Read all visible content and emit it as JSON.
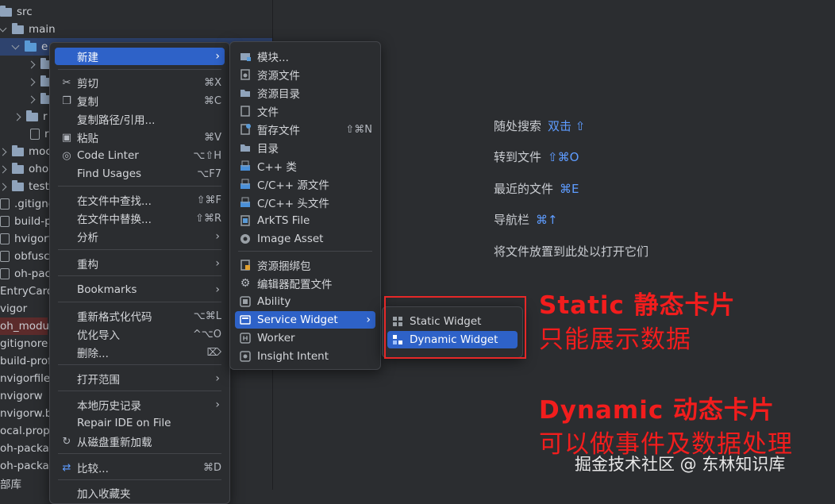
{
  "tree": {
    "items": [
      {
        "label": "src"
      },
      {
        "label": "main"
      },
      {
        "label": "e"
      },
      {
        "label": ""
      },
      {
        "label": ""
      },
      {
        "label": ""
      },
      {
        "label": "r"
      },
      {
        "label": "r"
      },
      {
        "label": "moc"
      },
      {
        "label": "oho"
      },
      {
        "label": "test"
      },
      {
        "label": ".gitignc"
      },
      {
        "label": "build-p"
      },
      {
        "label": "hvigorfi"
      },
      {
        "label": "obfusca"
      },
      {
        "label": "oh-pac"
      },
      {
        "label": "EntryCard"
      },
      {
        "label": "vigor"
      },
      {
        "label": "oh_modul"
      },
      {
        "label": "gitignore"
      },
      {
        "label": "build-profi"
      },
      {
        "label": "nvigorfile.t"
      },
      {
        "label": "nvigorw"
      },
      {
        "label": "nvigorw.ba"
      },
      {
        "label": "ocal.prop"
      },
      {
        "label": "oh-packag"
      },
      {
        "label": "oh-packag"
      },
      {
        "label": "部库"
      }
    ]
  },
  "context_menu": {
    "items": [
      {
        "label": "新建",
        "shortcut": "",
        "icon": ""
      },
      {
        "label": "剪切",
        "shortcut": "⌘X",
        "icon": "scissors-icon"
      },
      {
        "label": "复制",
        "shortcut": "⌘C",
        "icon": "copy-icon"
      },
      {
        "label": "复制路径/引用...",
        "shortcut": "",
        "icon": ""
      },
      {
        "label": "粘贴",
        "shortcut": "⌘V",
        "icon": "paste-icon"
      },
      {
        "label": "Code Linter",
        "shortcut": "⌥⇧H",
        "icon": "linter-icon"
      },
      {
        "label": "Find Usages",
        "shortcut": "⌥F7",
        "icon": ""
      },
      {
        "label": "在文件中查找...",
        "shortcut": "⇧⌘F",
        "icon": ""
      },
      {
        "label": "在文件中替换...",
        "shortcut": "⇧⌘R",
        "icon": ""
      },
      {
        "label": "分析",
        "shortcut": "",
        "icon": ""
      },
      {
        "label": "重构",
        "shortcut": "",
        "icon": ""
      },
      {
        "label": "Bookmarks",
        "shortcut": "",
        "icon": ""
      },
      {
        "label": "重新格式化代码",
        "shortcut": "⌥⌘L",
        "icon": ""
      },
      {
        "label": "优化导入",
        "shortcut": "^⌥O",
        "icon": ""
      },
      {
        "label": "删除...",
        "shortcut": "⌦",
        "icon": ""
      },
      {
        "label": "打开范围",
        "shortcut": "",
        "icon": ""
      },
      {
        "label": "本地历史记录",
        "shortcut": "",
        "icon": ""
      },
      {
        "label": "Repair IDE on File",
        "shortcut": "",
        "icon": ""
      },
      {
        "label": "从磁盘重新加载",
        "shortcut": "",
        "icon": "reload-icon"
      },
      {
        "label": "比较...",
        "shortcut": "⌘D",
        "icon": "compare-icon"
      },
      {
        "label": "加入收藏夹",
        "shortcut": "",
        "icon": ""
      }
    ]
  },
  "new_menu": {
    "items": [
      {
        "label": "模块...",
        "shortcut": "",
        "icon": "module-icon"
      },
      {
        "label": "资源文件",
        "shortcut": "",
        "icon": "resource-file-icon"
      },
      {
        "label": "资源目录",
        "shortcut": "",
        "icon": "folder-icon"
      },
      {
        "label": "文件",
        "shortcut": "",
        "icon": "file-icon"
      },
      {
        "label": "暂存文件",
        "shortcut": "⇧⌘N",
        "icon": "scratch-file-icon"
      },
      {
        "label": "目录",
        "shortcut": "",
        "icon": "directory-icon"
      },
      {
        "label": "C++ 类",
        "shortcut": "",
        "icon": "cpp-class-icon"
      },
      {
        "label": "C/C++ 源文件",
        "shortcut": "",
        "icon": "cpp-source-icon"
      },
      {
        "label": "C/C++ 头文件",
        "shortcut": "",
        "icon": "cpp-header-icon"
      },
      {
        "label": "ArkTS File",
        "shortcut": "",
        "icon": "arkts-icon"
      },
      {
        "label": "Image Asset",
        "shortcut": "",
        "icon": "image-asset-icon"
      },
      {
        "label": "资源捆绑包",
        "shortcut": "",
        "icon": "resource-bundle-icon"
      },
      {
        "label": "编辑器配置文件",
        "shortcut": "",
        "icon": "gear-icon"
      },
      {
        "label": "Ability",
        "shortcut": "",
        "icon": "ability-icon"
      },
      {
        "label": "Service Widget",
        "shortcut": "",
        "icon": "widget-icon"
      },
      {
        "label": "Worker",
        "shortcut": "",
        "icon": "worker-icon"
      },
      {
        "label": "Insight Intent",
        "shortcut": "",
        "icon": "intent-icon"
      }
    ]
  },
  "widget_menu": {
    "items": [
      {
        "label": "Static Widget",
        "icon": "static-widget-icon"
      },
      {
        "label": "Dynamic Widget",
        "icon": "dynamic-widget-icon"
      }
    ]
  },
  "hints": [
    {
      "label": "随处搜索",
      "key": "双击 ⇧"
    },
    {
      "label": "转到文件",
      "key": "⇧⌘O"
    },
    {
      "label": "最近的文件",
      "key": "⌘E"
    },
    {
      "label": "导航栏",
      "key": "⌘↑"
    },
    {
      "label": "将文件放置到此处以打开它们",
      "key": ""
    }
  ],
  "annotations": {
    "static_line1": "Static 静态卡片",
    "static_line2": "只能展示数据",
    "dynamic_line1": "Dynamic 动态卡片",
    "dynamic_line2": "可以做事件及数据处理"
  },
  "watermark": "掘金技术社区 @ 东林知识库",
  "colors": {
    "accent": "#2e62c8",
    "annotation": "#f21d1d",
    "hint_key": "#5e9cff"
  }
}
